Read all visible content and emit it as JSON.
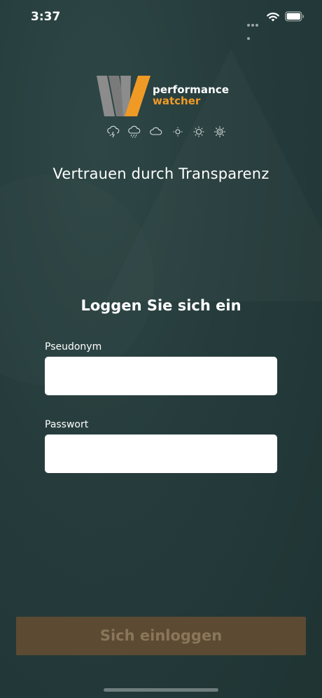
{
  "status_bar": {
    "time": "3:37",
    "icons": [
      "signal-dots-icon",
      "wifi-icon",
      "battery-icon"
    ]
  },
  "logo": {
    "line1": "performance",
    "line2": "watcher",
    "colors": {
      "accent": "#f09a26",
      "mark_gray": "#8c8c8c"
    }
  },
  "weather_icons": [
    "thunderstorm-icon",
    "rain-cloud-icon",
    "cloud-icon",
    "sun-small-icon",
    "sun-medium-icon",
    "sun-large-icon"
  ],
  "tagline": "Vertrauen durch Transparenz",
  "login": {
    "title": "Loggen Sie sich ein",
    "username_label": "Pseudonym",
    "username_value": "",
    "password_label": "Passwort",
    "password_value": "",
    "submit_label": "Sich einloggen"
  },
  "colors": {
    "background": "#263c3c",
    "button": "#5c4a33",
    "button_text": "#8a7658"
  }
}
